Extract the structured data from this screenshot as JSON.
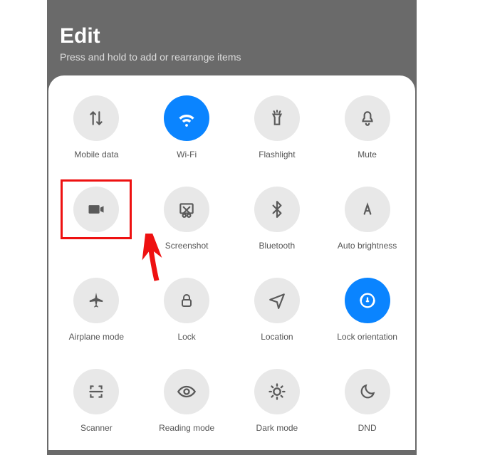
{
  "header": {
    "title": "Edit",
    "subtitle": "Press and hold to add or rearrange items"
  },
  "tiles": [
    {
      "id": "mobile-data",
      "label": "Mobile data",
      "active": false,
      "highlighted": false
    },
    {
      "id": "wifi",
      "label": "Wi-Fi",
      "active": true,
      "highlighted": false
    },
    {
      "id": "flashlight",
      "label": "Flashlight",
      "active": false,
      "highlighted": false
    },
    {
      "id": "mute",
      "label": "Mute",
      "active": false,
      "highlighted": false
    },
    {
      "id": "screen-record",
      "label": "",
      "active": false,
      "highlighted": true
    },
    {
      "id": "screenshot",
      "label": "Screenshot",
      "active": false,
      "highlighted": false
    },
    {
      "id": "bluetooth",
      "label": "Bluetooth",
      "active": false,
      "highlighted": false
    },
    {
      "id": "auto-brightness",
      "label": "Auto brightness",
      "active": false,
      "highlighted": false
    },
    {
      "id": "airplane-mode",
      "label": "Airplane mode",
      "active": false,
      "highlighted": false
    },
    {
      "id": "lock",
      "label": "Lock",
      "active": false,
      "highlighted": false
    },
    {
      "id": "location",
      "label": "Location",
      "active": false,
      "highlighted": false
    },
    {
      "id": "lock-orientation",
      "label": "Lock orientation",
      "active": true,
      "highlighted": false
    },
    {
      "id": "scanner",
      "label": "Scanner",
      "active": false,
      "highlighted": false
    },
    {
      "id": "reading-mode",
      "label": "Reading mode",
      "active": false,
      "highlighted": false
    },
    {
      "id": "dark-mode",
      "label": "Dark mode",
      "active": false,
      "highlighted": false
    },
    {
      "id": "dnd",
      "label": "DND",
      "active": false,
      "highlighted": false
    }
  ],
  "colors": {
    "accent": "#0a84ff",
    "highlight": "#e11"
  }
}
